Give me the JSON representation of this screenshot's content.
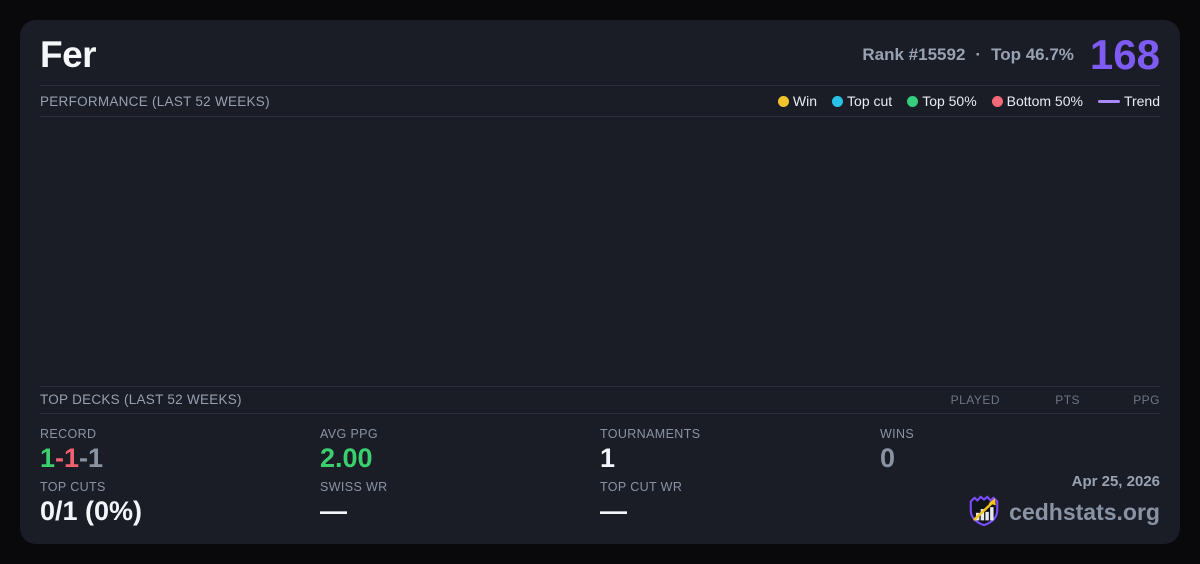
{
  "colors": {
    "page_bg": "#09090c",
    "card_bg": "#1a1d26",
    "divider": "#2b3040",
    "accent_purple": "#7e5bf2",
    "trend_purple": "#a78bfa",
    "win_yellow": "#f0c42a",
    "top_cut_cyan": "#2ac3e8",
    "top50_green": "#36cd7c",
    "bottom50_red": "#f16a75",
    "value_green": "#3bd06e",
    "value_red": "#f1606e",
    "value_gray": "#8a93a4",
    "text_white": "#f5f7fb",
    "text_gray": "#99a2b2",
    "logo_purple": "#7c4dff",
    "logo_yellow": "#f5c518"
  },
  "header": {
    "title": "Fer",
    "rank": "Rank #15592",
    "separator": "·",
    "top_percent": "Top 46.7%",
    "score": "168"
  },
  "performance": {
    "title": "PERFORMANCE (LAST 52 WEEKS)",
    "legend": {
      "win": "Win",
      "top_cut": "Top cut",
      "top_50": "Top 50%",
      "bottom_50": "Bottom 50%",
      "trend": "Trend"
    }
  },
  "top_decks": {
    "title": "TOP DECKS (LAST 52 WEEKS)",
    "columns": [
      "PLAYED",
      "PTS",
      "PPG"
    ],
    "rows": []
  },
  "stats": {
    "record": {
      "label": "RECORD",
      "parts": [
        "1",
        "-1",
        "-1"
      ]
    },
    "avg_ppg": {
      "label": "AVG PPG",
      "value": "2.00"
    },
    "tournaments": {
      "label": "TOURNAMENTS",
      "value": "1"
    },
    "wins": {
      "label": "WINS",
      "value": "0"
    },
    "top_cuts": {
      "label": "TOP CUTS",
      "value": "0/1 (0%)"
    },
    "swiss_wr": {
      "label": "SWISS WR",
      "value": "—"
    },
    "top_cut_wr": {
      "label": "TOP CUT WR",
      "value": "—"
    }
  },
  "footer": {
    "date": "Apr 25, 2026",
    "brand": "cedhstats.org"
  }
}
